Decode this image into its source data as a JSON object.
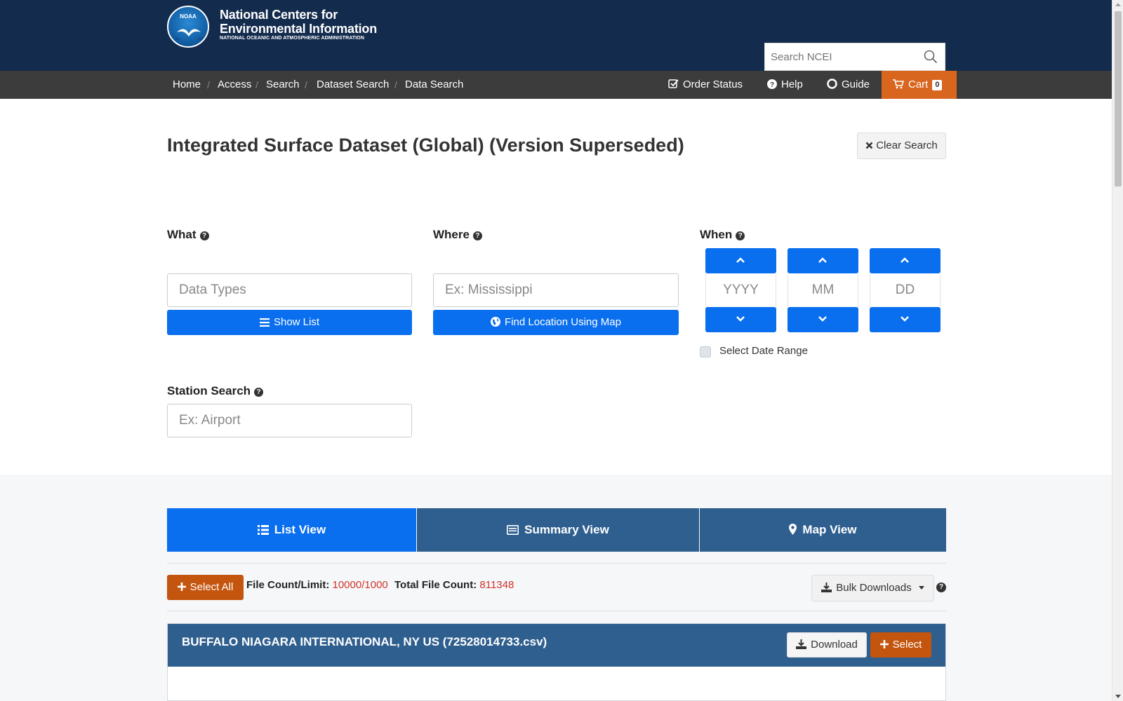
{
  "header": {
    "logo_text": "NOAA",
    "org_line1": "National Centers for",
    "org_line2": "Environmental Information",
    "org_line3": "NATIONAL OCEANIC AND ATMOSPHERIC ADMINISTRATION",
    "search_placeholder": "Search NCEI"
  },
  "breadcrumb": [
    "Home",
    "Access",
    "Search",
    "Dataset Search",
    "Data Search"
  ],
  "nav": {
    "order_status": "Order Status",
    "help": "Help",
    "guide": "Guide",
    "cart": "Cart",
    "cart_count": "0"
  },
  "page": {
    "title": "Integrated Surface Dataset (Global) (Version Superseded)",
    "clear_search": "Clear Search"
  },
  "what": {
    "label": "What",
    "placeholder": "Data Types",
    "button": "Show List"
  },
  "where": {
    "label": "Where",
    "placeholder": "Ex: Mississippi",
    "button": "Find Location Using Map"
  },
  "when": {
    "label": "When",
    "year_placeholder": "YYYY",
    "month_placeholder": "MM",
    "day_placeholder": "DD",
    "date_range_label": "Select Date Range"
  },
  "station": {
    "label": "Station Search",
    "placeholder": "Ex: Airport"
  },
  "tabs": [
    {
      "label": "List View",
      "active": true,
      "icon": "list-icon"
    },
    {
      "label": "Summary View",
      "active": false,
      "icon": "summary-icon"
    },
    {
      "label": "Map View",
      "active": false,
      "icon": "map-marker-icon"
    }
  ],
  "results": {
    "select_all": "Select All",
    "file_count_label": "File Count/Limit:",
    "file_count_value": "10000/1000",
    "total_label": "Total File Count:",
    "total_value": "811348",
    "bulk_downloads": "Bulk Downloads",
    "items": [
      {
        "title": "BUFFALO NIAGARA INTERNATIONAL, NY US (72528014733.csv)",
        "download": "Download",
        "select": "Select"
      }
    ]
  },
  "colors": {
    "header_bg": "#132b4d",
    "nav_bg": "#3c3c3c",
    "accent_blue": "#0a6fef",
    "accent_orange": "#d9661f",
    "tab_inactive": "#2f5f8f",
    "count_red": "#d0342c"
  }
}
